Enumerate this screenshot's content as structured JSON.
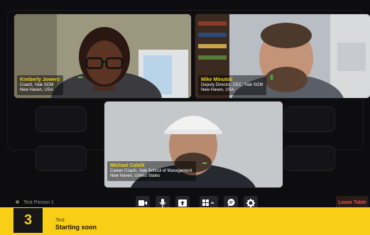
{
  "participants": [
    {
      "name": "Kimberly Jowers",
      "title": "Coach, Yale SOM",
      "location": "New Haven, USA",
      "audio_color": "#7ed957"
    },
    {
      "name": "Mike Minutoli",
      "title": "Deputy Director, CEC, Yale SOM",
      "location": "New Haven, USA",
      "audio_color": "#39d353"
    },
    {
      "name": "Michael Colelli",
      "title": "Career Coach, Yale School of Management",
      "location": "New Haven, United States",
      "audio_color": "#7ed957"
    }
  ],
  "table": {
    "label": "Test Person 1"
  },
  "toolbar": {
    "buttons": [
      "camera-icon",
      "microphone-icon",
      "share-screen-icon",
      "grid-layout-icon",
      "chat-icon",
      "gear-icon"
    ],
    "leave_label": "Leave Table",
    "leave_color": "#f2553b"
  },
  "banner": {
    "count": "3",
    "tag": "Test",
    "status": "Starting soon",
    "color": "#f8cf16"
  },
  "colors": {
    "name_highlight": "#f7d21c",
    "background": "#0d0d0f"
  }
}
